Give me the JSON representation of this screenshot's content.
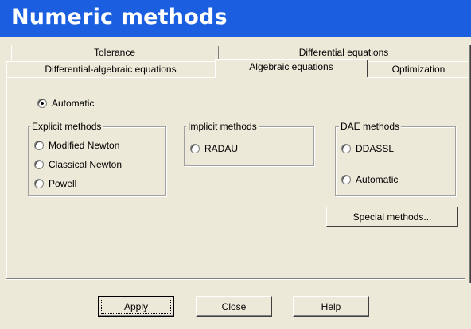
{
  "window": {
    "title": "Numeric methods"
  },
  "tabs": {
    "top": [
      {
        "label": "Tolerance"
      },
      {
        "label": "Differential equations"
      }
    ],
    "bottom": [
      {
        "label": "Differential-algebraic equations"
      },
      {
        "label": "Algebraic equations",
        "selected": true
      },
      {
        "label": "Optimization"
      }
    ]
  },
  "panel": {
    "automatic": {
      "label": "Automatic",
      "checked": true
    },
    "explicit": {
      "title": "Explicit methods",
      "options": [
        {
          "label": "Modified Newton",
          "checked": false
        },
        {
          "label": "Classical Newton",
          "checked": false
        },
        {
          "label": "Powell",
          "checked": false
        }
      ]
    },
    "implicit": {
      "title": "Implicit methods",
      "options": [
        {
          "label": "RADAU",
          "checked": false
        }
      ]
    },
    "dae": {
      "title": "DAE methods",
      "options": [
        {
          "label": "DDASSL",
          "checked": false
        },
        {
          "label": "Automatic",
          "checked": false
        }
      ]
    },
    "special_button": "Special methods..."
  },
  "footer": {
    "apply": "Apply",
    "close": "Close",
    "help": "Help"
  }
}
